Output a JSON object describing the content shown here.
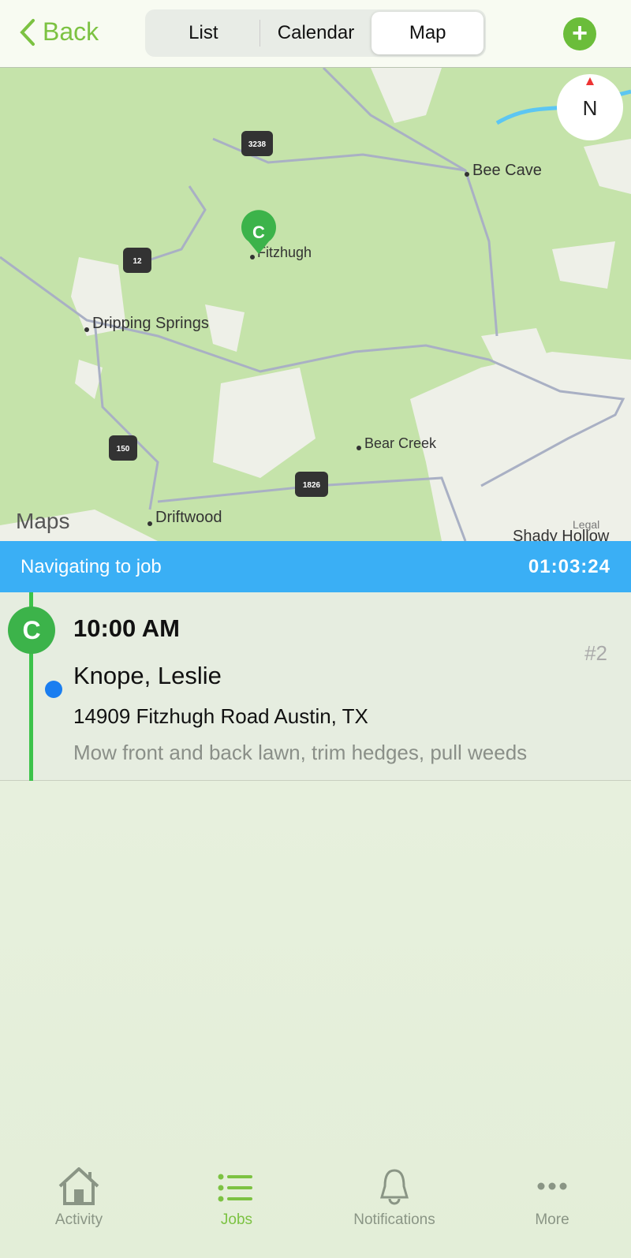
{
  "header": {
    "back_label": "Back",
    "segments": [
      "List",
      "Calendar",
      "Map"
    ],
    "selected_segment": "Map",
    "add_icon": "plus-icon"
  },
  "map": {
    "places": [
      "Bee Cave",
      "Fitzhugh",
      "Dripping Springs",
      "Bear Creek",
      "Driftwood",
      "Shady Hollow"
    ],
    "shields": [
      "3238",
      "12",
      "150",
      "1826"
    ],
    "pin_label": "C",
    "compass": "N",
    "attribution": "Maps",
    "legal": "Legal"
  },
  "navigation": {
    "status": "Navigating to job",
    "timer": "01:03:24",
    "color": "#3aaff5"
  },
  "job": {
    "badge": "C",
    "time": "10:00 AM",
    "number": "#2",
    "customer": "Knope, Leslie",
    "address": "14909 Fitzhugh Road Austin, TX",
    "description": "Mow front and back lawn, trim hedges, pull weeds"
  },
  "tabbar": {
    "items": [
      {
        "label": "Activity",
        "icon": "house-icon"
      },
      {
        "label": "Jobs",
        "icon": "list-icon"
      },
      {
        "label": "Notifications",
        "icon": "bell-icon"
      },
      {
        "label": "More",
        "icon": "more-icon"
      }
    ],
    "active": "Jobs",
    "accent": "#7cc242"
  }
}
